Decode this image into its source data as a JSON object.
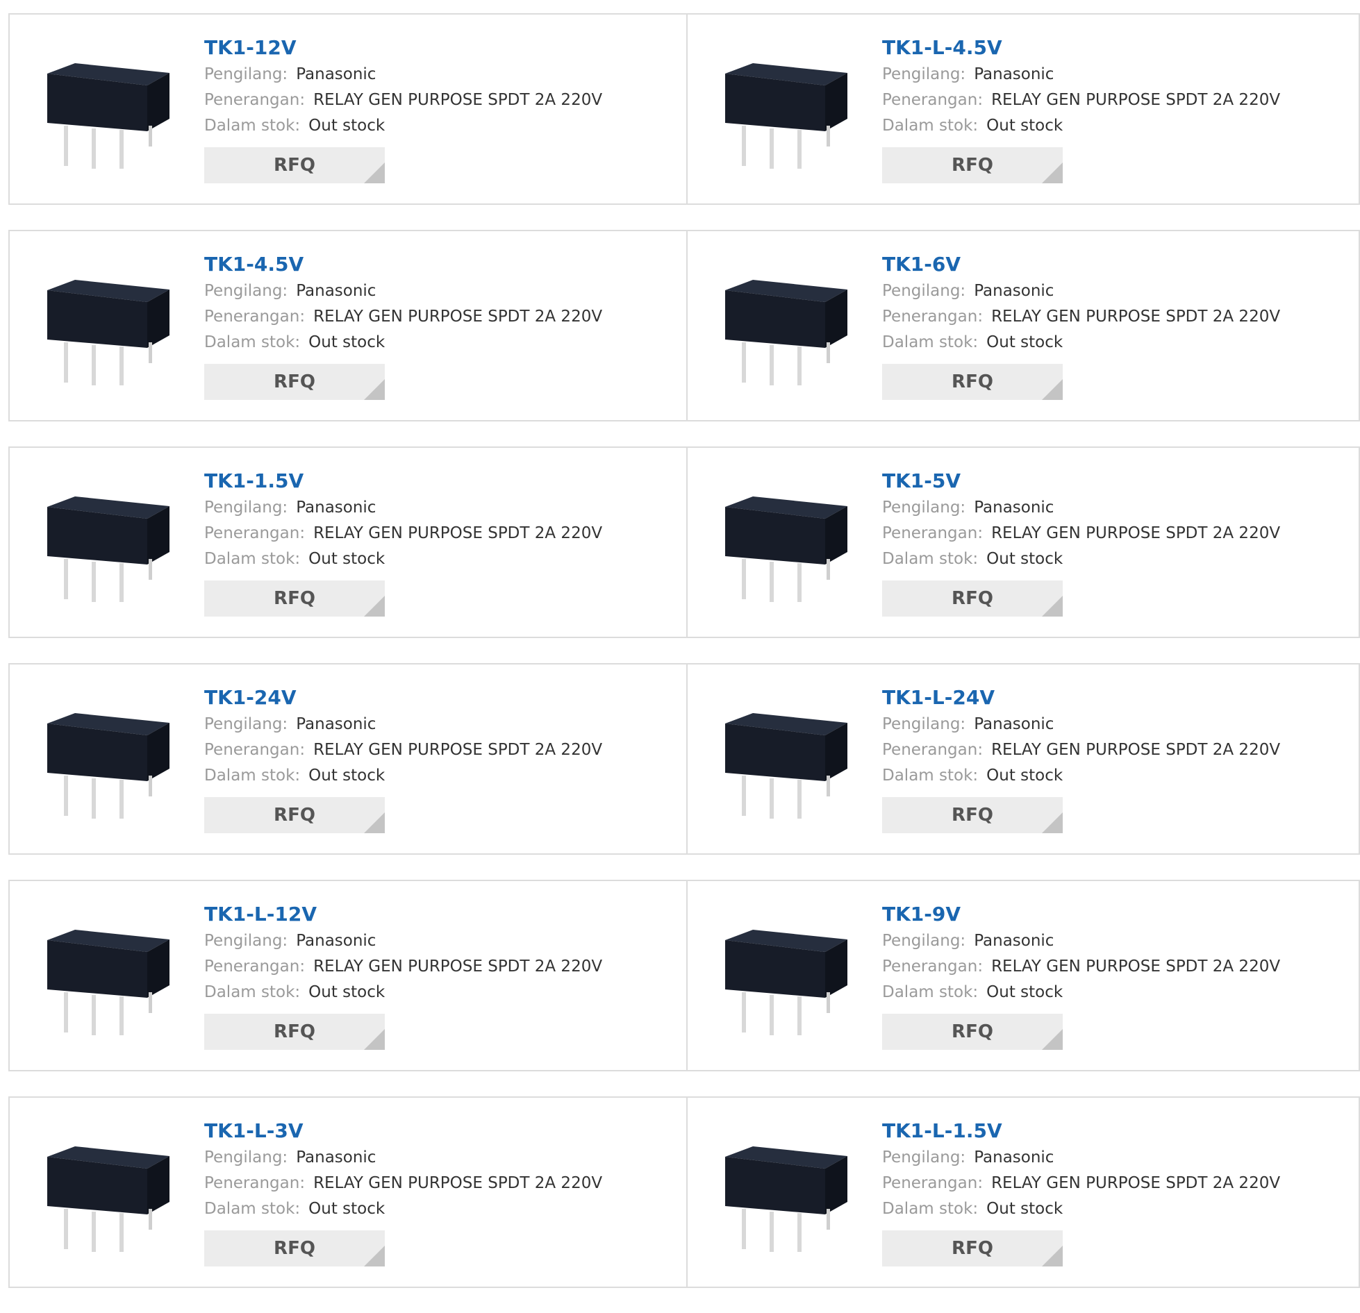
{
  "labels": {
    "manufacturer": "Pengilang:",
    "description": "Penerangan:",
    "stock": "Dalam stok:",
    "rfq": "RFQ"
  },
  "products": [
    {
      "part": "TK1-12V",
      "manufacturer": "Panasonic",
      "description": "RELAY GEN PURPOSE SPDT 2A 220V",
      "stock": "Out stock"
    },
    {
      "part": "TK1-L-4.5V",
      "manufacturer": "Panasonic",
      "description": "RELAY GEN PURPOSE SPDT 2A 220V",
      "stock": "Out stock"
    },
    {
      "part": "TK1-4.5V",
      "manufacturer": "Panasonic",
      "description": "RELAY GEN PURPOSE SPDT 2A 220V",
      "stock": "Out stock"
    },
    {
      "part": "TK1-6V",
      "manufacturer": "Panasonic",
      "description": "RELAY GEN PURPOSE SPDT 2A 220V",
      "stock": "Out stock"
    },
    {
      "part": "TK1-1.5V",
      "manufacturer": "Panasonic",
      "description": "RELAY GEN PURPOSE SPDT 2A 220V",
      "stock": "Out stock"
    },
    {
      "part": "TK1-5V",
      "manufacturer": "Panasonic",
      "description": "RELAY GEN PURPOSE SPDT 2A 220V",
      "stock": "Out stock"
    },
    {
      "part": "TK1-24V",
      "manufacturer": "Panasonic",
      "description": "RELAY GEN PURPOSE SPDT 2A 220V",
      "stock": "Out stock"
    },
    {
      "part": "TK1-L-24V",
      "manufacturer": "Panasonic",
      "description": "RELAY GEN PURPOSE SPDT 2A 220V",
      "stock": "Out stock"
    },
    {
      "part": "TK1-L-12V",
      "manufacturer": "Panasonic",
      "description": "RELAY GEN PURPOSE SPDT 2A 220V",
      "stock": "Out stock"
    },
    {
      "part": "TK1-9V",
      "manufacturer": "Panasonic",
      "description": "RELAY GEN PURPOSE SPDT 2A 220V",
      "stock": "Out stock"
    },
    {
      "part": "TK1-L-3V",
      "manufacturer": "Panasonic",
      "description": "RELAY GEN PURPOSE SPDT 2A 220V",
      "stock": "Out stock"
    },
    {
      "part": "TK1-L-1.5V",
      "manufacturer": "Panasonic",
      "description": "RELAY GEN PURPOSE SPDT 2A 220V",
      "stock": "Out stock"
    }
  ],
  "colors": {
    "part_link": "#1a66b0",
    "label": "#9a9a9a",
    "value": "#333333",
    "rfq_bg": "#ececec",
    "border": "#dcdcdc"
  },
  "icons": {
    "product_image": "relay-product-image",
    "rfq_corner": "rfq-corner-icon"
  }
}
